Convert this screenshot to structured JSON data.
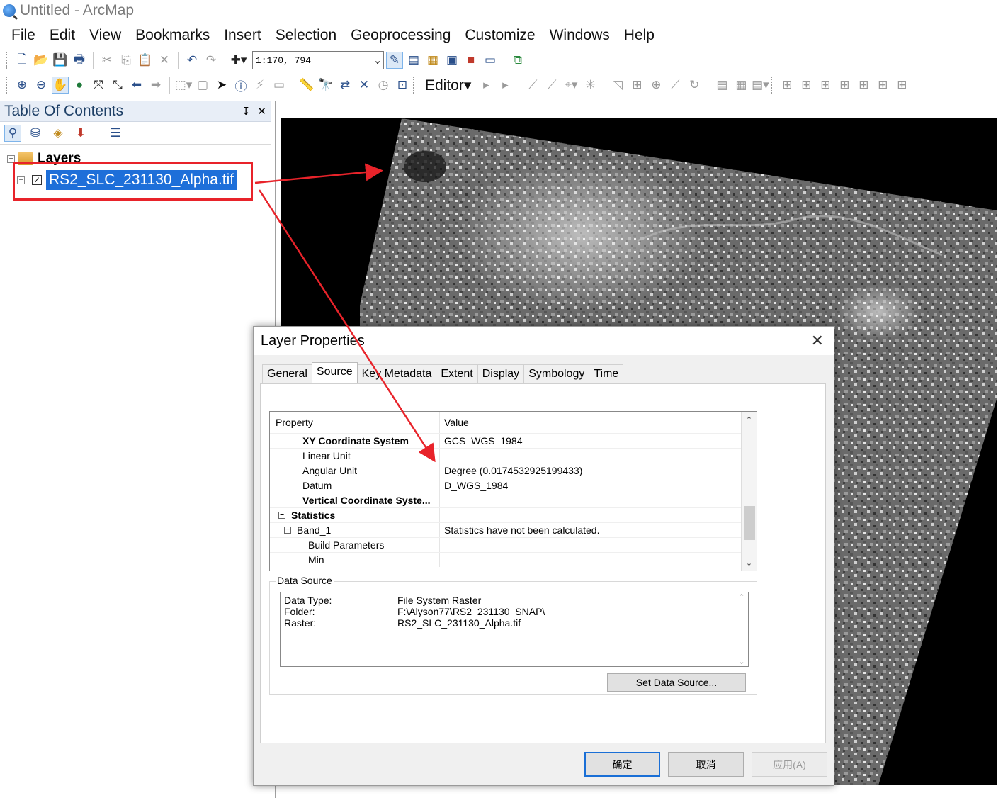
{
  "window": {
    "title": "Untitled - ArcMap"
  },
  "menu": [
    "File",
    "Edit",
    "View",
    "Bookmarks",
    "Insert",
    "Selection",
    "Geoprocessing",
    "Customize",
    "Windows",
    "Help"
  ],
  "toolbar": {
    "scale": "1:170, 794",
    "editor_label": "Editor"
  },
  "toc": {
    "title": "Table Of Contents",
    "pin": "↧",
    "close": "✕",
    "root_label": "Layers",
    "layer_name": "RS2_SLC_231130_Alpha.tif"
  },
  "dialog": {
    "title": "Layer Properties",
    "close": "✕",
    "tabs": [
      "General",
      "Source",
      "Key Metadata",
      "Extent",
      "Display",
      "Symbology",
      "Time"
    ],
    "grid": {
      "col_property": "Property",
      "col_value": "Value",
      "rows": [
        {
          "property": "XY Coordinate System",
          "value": "GCS_WGS_1984"
        },
        {
          "property": "Linear Unit",
          "value": ""
        },
        {
          "property": "Angular Unit",
          "value": "Degree (0.0174532925199433)"
        },
        {
          "property": "Datum",
          "value": "D_WGS_1984"
        },
        {
          "property": "Vertical Coordinate Syste...",
          "value": ""
        },
        {
          "property": "Statistics",
          "value": ""
        },
        {
          "property": "Band_1",
          "value": "Statistics have not been calculated."
        },
        {
          "property": "Build Parameters",
          "value": ""
        },
        {
          "property": "Min",
          "value": ""
        }
      ]
    },
    "data_source": {
      "legend": "Data Source",
      "rows": [
        {
          "key": "Data Type:",
          "value": "File System Raster"
        },
        {
          "key": "Folder:",
          "value": "F:\\Alyson77\\RS2_231130_SNAP\\"
        },
        {
          "key": "Raster:",
          "value": "RS2_SLC_231130_Alpha.tif"
        }
      ],
      "button": "Set Data Source..."
    },
    "buttons": {
      "ok": "确定",
      "cancel": "取消",
      "apply": "应用(A)"
    }
  },
  "colors": {
    "highlight": "#1e6fd9",
    "annotation_red": "#e8232a"
  }
}
